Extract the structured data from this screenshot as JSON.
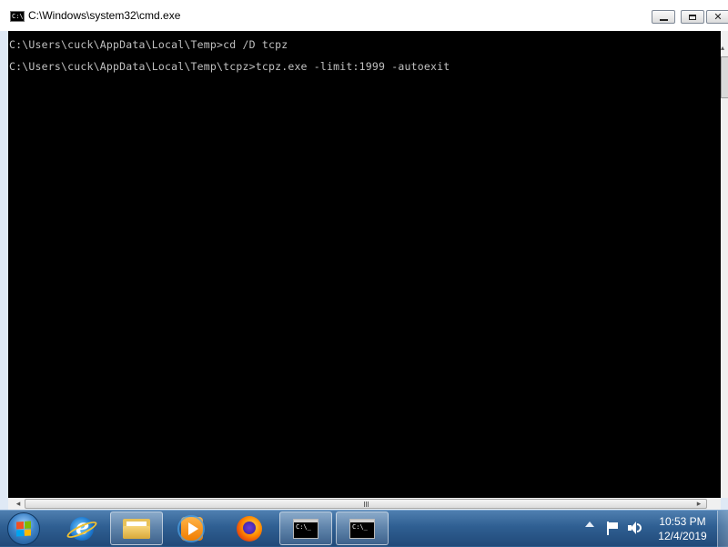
{
  "window": {
    "title": "C:\\Windows\\system32\\cmd.exe",
    "icon": "cmd-icon",
    "buttons": {
      "minimize": "minimize-icon",
      "maximize": "maximize-icon",
      "close": "close-icon",
      "close_glyph": "✕"
    }
  },
  "console": {
    "lines": [
      "C:\\Users\\cuck\\AppData\\Local\\Temp>cd /D tcpz",
      "C:\\Users\\cuck\\AppData\\Local\\Temp\\tcpz>tcpz.exe -limit:1999 -autoexit"
    ],
    "background": "#000000",
    "text_color": "#c0c0c0"
  },
  "scrollbars": {
    "vertical_up_arrow": "▴",
    "horizontal_left_arrow": "◂",
    "horizontal_right_arrow": "▸"
  },
  "taskbar": {
    "start": "windows-start-orb",
    "items": [
      {
        "name": "internet-explorer",
        "icon": "ie-icon",
        "active": false
      },
      {
        "name": "windows-explorer",
        "icon": "folder-icon",
        "active": true
      },
      {
        "name": "windows-media-player",
        "icon": "media-player-icon",
        "active": false
      },
      {
        "name": "firefox",
        "icon": "firefox-icon",
        "active": false
      },
      {
        "name": "command-prompt-1",
        "icon": "cmd-icon",
        "active": true
      },
      {
        "name": "command-prompt-2",
        "icon": "cmd-icon",
        "active": true
      }
    ],
    "cmd_icon_text": "C:\\_",
    "tray": {
      "icons": [
        "show-hidden-icons-arrow",
        "action-center-flag-icon",
        "speaker-icon"
      ],
      "time": "10:53 PM",
      "date": "12/4/2019"
    }
  },
  "colors": {
    "taskbar": "#2f5f92",
    "console_bg": "#000000",
    "window_frame": "#dfe9f5"
  }
}
